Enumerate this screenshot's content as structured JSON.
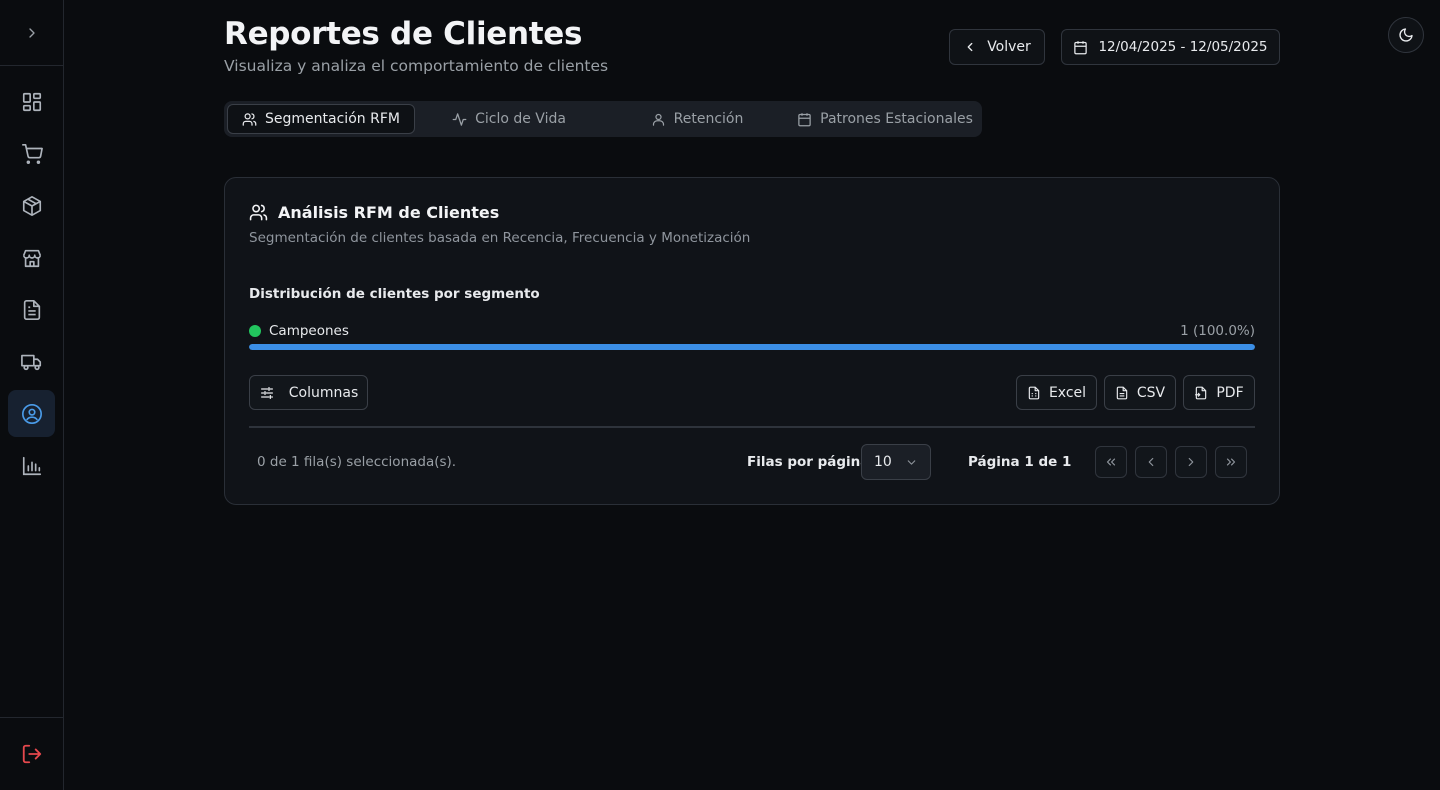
{
  "header": {
    "title": "Reportes de Clientes",
    "subtitle": "Visualiza y analiza el comportamiento de clientes",
    "back_label": "Volver",
    "date_range": "12/04/2025 - 12/05/2025"
  },
  "sidebar": {
    "items": [
      {
        "icon": "dashboard-icon"
      },
      {
        "icon": "cart-icon"
      },
      {
        "icon": "package-icon"
      },
      {
        "icon": "store-icon"
      },
      {
        "icon": "document-icon"
      },
      {
        "icon": "truck-icon"
      },
      {
        "icon": "user-circle-icon",
        "active": true
      },
      {
        "icon": "bar-chart-icon"
      }
    ],
    "logout_icon": "logout-icon"
  },
  "tabs": [
    {
      "label": "Segmentación RFM",
      "icon": "users-icon",
      "active": true
    },
    {
      "label": "Ciclo de Vida",
      "icon": "activity-icon"
    },
    {
      "label": "Retención",
      "icon": "user-icon"
    },
    {
      "label": "Patrones Estacionales",
      "icon": "calendar-icon"
    }
  ],
  "card": {
    "title": "Análisis RFM de Clientes",
    "description": "Segmentación de clientes basada en Recencia, Frecuencia y Monetización",
    "distribution_title": "Distribución de clientes por segmento",
    "segments": [
      {
        "name": "Campeones",
        "value_label": "1 (100.0%)",
        "fraction": 1.0,
        "color": "#22c55e"
      }
    ],
    "bar_color": "#3b8ee6",
    "columns_label": "Columnas",
    "export": {
      "excel": "Excel",
      "csv": "CSV",
      "pdf": "PDF"
    },
    "selection_text": "0 de 1 fila(s) seleccionada(s).",
    "rows_per_page_label": "Filas por página",
    "rows_per_page_value": "10",
    "page_label": "Página 1 de 1"
  },
  "colors": {
    "background": "#0a0c0f",
    "accent": "#4a9be8",
    "logout": "#e5484d"
  }
}
